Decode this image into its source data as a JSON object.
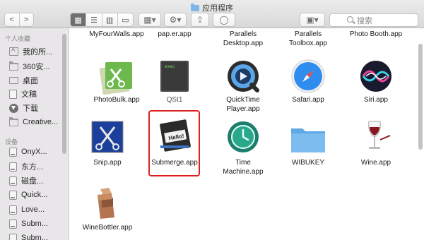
{
  "window": {
    "title": "应用程序"
  },
  "toolbar": {
    "back": "<",
    "forward": ">",
    "search_placeholder": "搜索",
    "view_icons": [
      "icon-view-icon",
      "list-view-icon",
      "column-view-icon",
      "cover-flow-icon"
    ]
  },
  "sidebar": {
    "favorites_heading": "个人收藏",
    "favorites": [
      {
        "label": "我的所...",
        "icon": "apps-folder-icon"
      },
      {
        "label": "360安...",
        "icon": "folder-icon"
      },
      {
        "label": "桌面",
        "icon": "desktop-icon"
      },
      {
        "label": "文稿",
        "icon": "document-icon"
      },
      {
        "label": "下载",
        "icon": "download-icon"
      },
      {
        "label": "Creative...",
        "icon": "folder-icon"
      }
    ],
    "devices_heading": "设备",
    "devices": [
      {
        "label": "OnyX...",
        "icon": "disk-icon"
      },
      {
        "label": "东方...",
        "icon": "disk-icon"
      },
      {
        "label": "磁盘...",
        "icon": "disk-icon"
      },
      {
        "label": "Quick...",
        "icon": "disk-icon"
      },
      {
        "label": "Love...",
        "icon": "disk-icon"
      },
      {
        "label": "Subm...",
        "icon": "disk-icon"
      },
      {
        "label": "Subm...",
        "icon": "disk-icon"
      }
    ]
  },
  "files": {
    "row0": [
      "MyFourWalls.app",
      "pap.er.app",
      "Parallels\nDesktop.app",
      "Parallels\nToolbox.app",
      "Photo Booth.app"
    ],
    "row1": [
      "PhotoBulk.app",
      "QSt1",
      "QuickTime\nPlayer.app",
      "Safari.app",
      "Siri.app"
    ],
    "row2": [
      "Snip.app",
      "Submerge.app",
      "Time\nMachine.app",
      "WIBUKEY",
      "Wine.app"
    ],
    "row3": [
      "WineBottler.app"
    ],
    "selected": "Submerge.app",
    "qst1_badge": "exec",
    "submerge_badge": "Hello!"
  },
  "colors": {
    "selection_outline": "#e02020",
    "folder_blue": "#6cb5ea"
  }
}
